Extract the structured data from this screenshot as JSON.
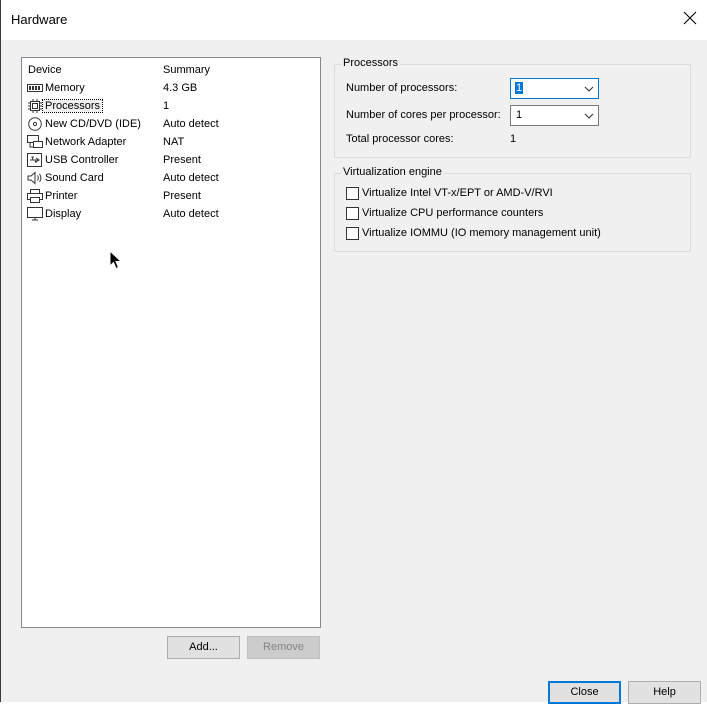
{
  "window": {
    "title": "Hardware"
  },
  "devices": {
    "col_device": "Device",
    "col_summary": "Summary",
    "items": [
      {
        "name": "Memory",
        "summary": "4.3 GB",
        "icon": "memory-icon"
      },
      {
        "name": "Processors",
        "summary": "1",
        "icon": "processor-icon"
      },
      {
        "name": "New CD/DVD (IDE)",
        "summary": "Auto detect",
        "icon": "cd-dvd-icon"
      },
      {
        "name": "Network Adapter",
        "summary": "NAT",
        "icon": "network-adapter-icon"
      },
      {
        "name": "USB Controller",
        "summary": "Present",
        "icon": "usb-icon"
      },
      {
        "name": "Sound Card",
        "summary": "Auto detect",
        "icon": "speaker-icon"
      },
      {
        "name": "Printer",
        "summary": "Present",
        "icon": "printer-icon"
      },
      {
        "name": "Display",
        "summary": "Auto detect",
        "icon": "monitor-icon"
      }
    ],
    "selected": "Processors"
  },
  "buttons": {
    "add": "Add...",
    "remove": "Remove",
    "close": "Close",
    "help": "Help"
  },
  "processors": {
    "group_label": "Processors",
    "num_processors_label": "Number of processors:",
    "num_processors_value": "1",
    "cores_label": "Number of cores per processor:",
    "cores_value": "1",
    "total_label": "Total processor cores:",
    "total_value": "1"
  },
  "virtualization": {
    "group_label": "Virtualization engine",
    "options": [
      {
        "label": "Virtualize Intel VT-x/EPT or AMD-V/RVI",
        "checked": false
      },
      {
        "label": "Virtualize CPU performance counters",
        "checked": false
      },
      {
        "label": "Virtualize IOMMU (IO memory management unit)",
        "checked": false
      }
    ]
  },
  "colors": {
    "accent": "#0078d7",
    "face": "#f0f0f0"
  }
}
